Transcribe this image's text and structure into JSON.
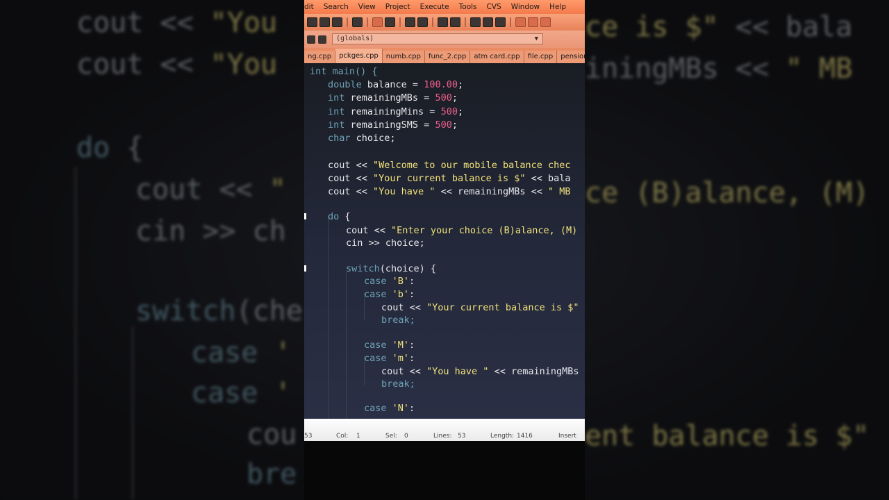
{
  "menu": [
    "dit",
    "Search",
    "View",
    "Project",
    "Execute",
    "Tools",
    "CVS",
    "Window",
    "Help"
  ],
  "globals_value": "(globals)",
  "tabs": [
    "ng.cpp",
    "pckges.cpp",
    "numb.cpp",
    "func_2.cpp",
    "atm card.cpp",
    "file.cpp",
    "pension.cpp"
  ],
  "active_tab": "pckges.cpp",
  "code": {
    "l1": "int main() {",
    "l2a": "double",
    "l2b": " balance = ",
    "l2c": "100.00",
    "l2d": ";",
    "l3a": "int",
    "l3b": " remainingMBs = ",
    "l3c": "500",
    "l3d": ";",
    "l4a": "int",
    "l4b": " remainingMins = ",
    "l4c": "500",
    "l4d": ";",
    "l5a": "int",
    "l5b": " remainingSMS = ",
    "l5c": "500",
    "l5d": ";",
    "l6a": "char",
    "l6b": " choice;",
    "l7a": "cout << ",
    "l7b": "\"Welcome to our mobile balance chec",
    "l8a": "cout << ",
    "l8b": "\"Your current balance is $\"",
    "l8c": " << bala",
    "l9a": "cout << ",
    "l9b": "\"You have \"",
    "l9c": " << remainingMBs << ",
    "l9d": "\" MB",
    "l10a": "do",
    "l10b": " {",
    "l11a": "cout << ",
    "l11b": "\"Enter your choice (B)alance, (M)",
    "l12": "cin >> choice;",
    "l13a": "switch",
    "l13b": "(choice) {",
    "l14a": "case ",
    "l14b": "'B'",
    "l14c": ":",
    "l15a": "case ",
    "l15b": "'b'",
    "l15c": ":",
    "l16a": "cout << ",
    "l16b": "\"Your current balance is $\"",
    "l17": "break;",
    "l18a": "case ",
    "l18b": "'M'",
    "l18c": ":",
    "l19a": "case ",
    "l19b": "'m'",
    "l19c": ":",
    "l20a": "cout << ",
    "l20b": "\"You have \"",
    "l20c": " << remainingMBs",
    "l21": "break;",
    "l22a": "case ",
    "l22b": "'N'",
    "l22c": ":"
  },
  "status": {
    "line": "53",
    "col_label": "Col:",
    "col": "1",
    "sel_label": "Sel:",
    "sel": "0",
    "lines_label": "Lines:",
    "lines": "53",
    "length_label": "Length:",
    "length": "1416",
    "mode": "Insert"
  },
  "bg": {
    "a1": "cout << ",
    "a2": "\"You",
    "b1": "cout << ",
    "b2": "\"You",
    "c1": "do",
    "c2": " {",
    "d1": "cout << ",
    "d2": "\"",
    "e1": "cin >> ch",
    "f1": "switch",
    "f2": "(che",
    "g1": "case ",
    "g2": "'",
    "h1": "case ",
    "h2": "'",
    "i1": "cou",
    "j1": "bre",
    "r1": "ce is $\"",
    "r2": " << bala",
    "r3": "iningMBs << ",
    "r4": "\" MB",
    "r5": "ce (B)alance, (M)",
    "r6": "ent balance is $\""
  }
}
